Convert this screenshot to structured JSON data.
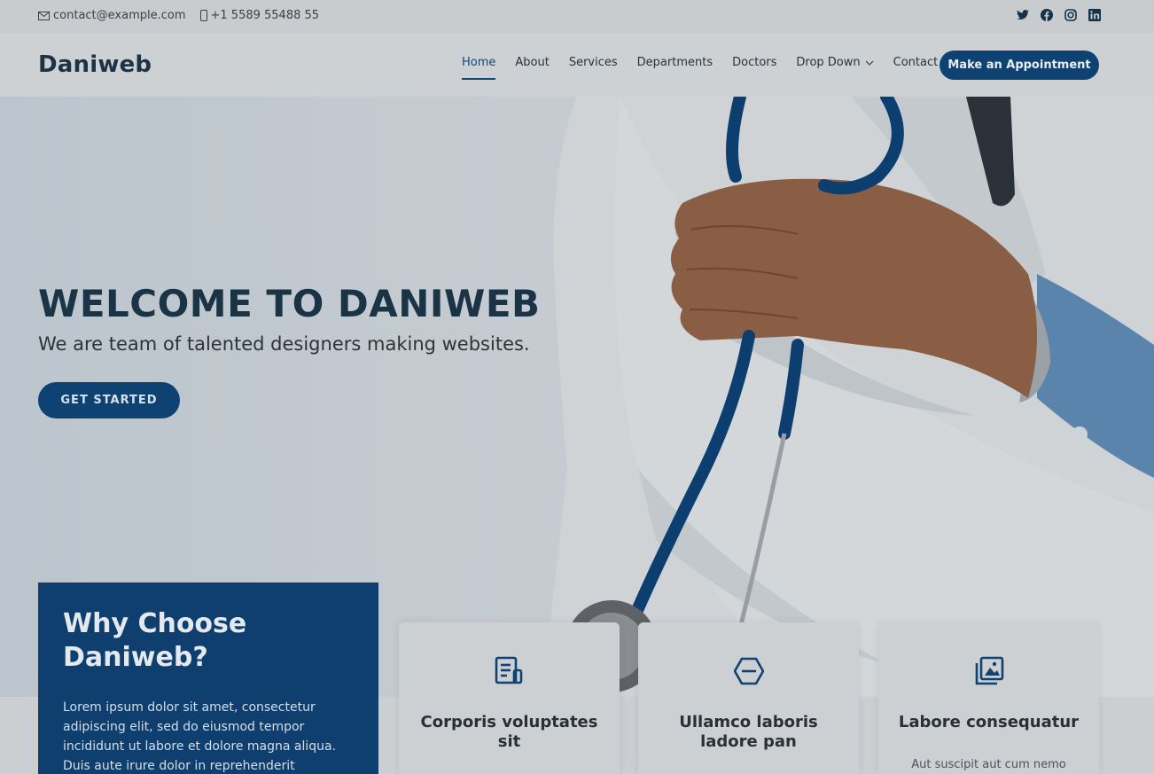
{
  "topbar": {
    "email": "contact@example.com",
    "phone": "+1 5589 55488 55",
    "social": [
      "twitter-icon",
      "facebook-icon",
      "instagram-icon",
      "linkedin-icon"
    ]
  },
  "header": {
    "logo": "Daniweb",
    "nav": [
      "Home",
      "About",
      "Services",
      "Departments",
      "Doctors",
      "Drop Down",
      "Contact"
    ],
    "active": "Home",
    "cta": "Make an Appointment"
  },
  "hero": {
    "title": "WELCOME TO DANIWEB",
    "subtitle": "We are team of talented designers making websites.",
    "button": "GET STARTED"
  },
  "why": {
    "title": "Why Choose Daniweb?",
    "body": "Lorem ipsum dolor sit amet, consectetur adipiscing elit, sed do eiusmod tempor incididunt ut labore et dolore magna aliqua. Duis aute irure dolor in reprehenderit"
  },
  "cards": [
    {
      "icon": "document-icon",
      "title": "Corporis voluptates sit",
      "desc": ""
    },
    {
      "icon": "hexagon-icon",
      "title": "Ullamco laboris ladore pan",
      "desc": ""
    },
    {
      "icon": "images-icon",
      "title": "Labore consequatur",
      "desc": "Aut suscipit aut cum nemo"
    }
  ],
  "colors": {
    "primary": "#0e4273",
    "why_bg": "#0e3f6e",
    "heading": "#1a3446"
  }
}
